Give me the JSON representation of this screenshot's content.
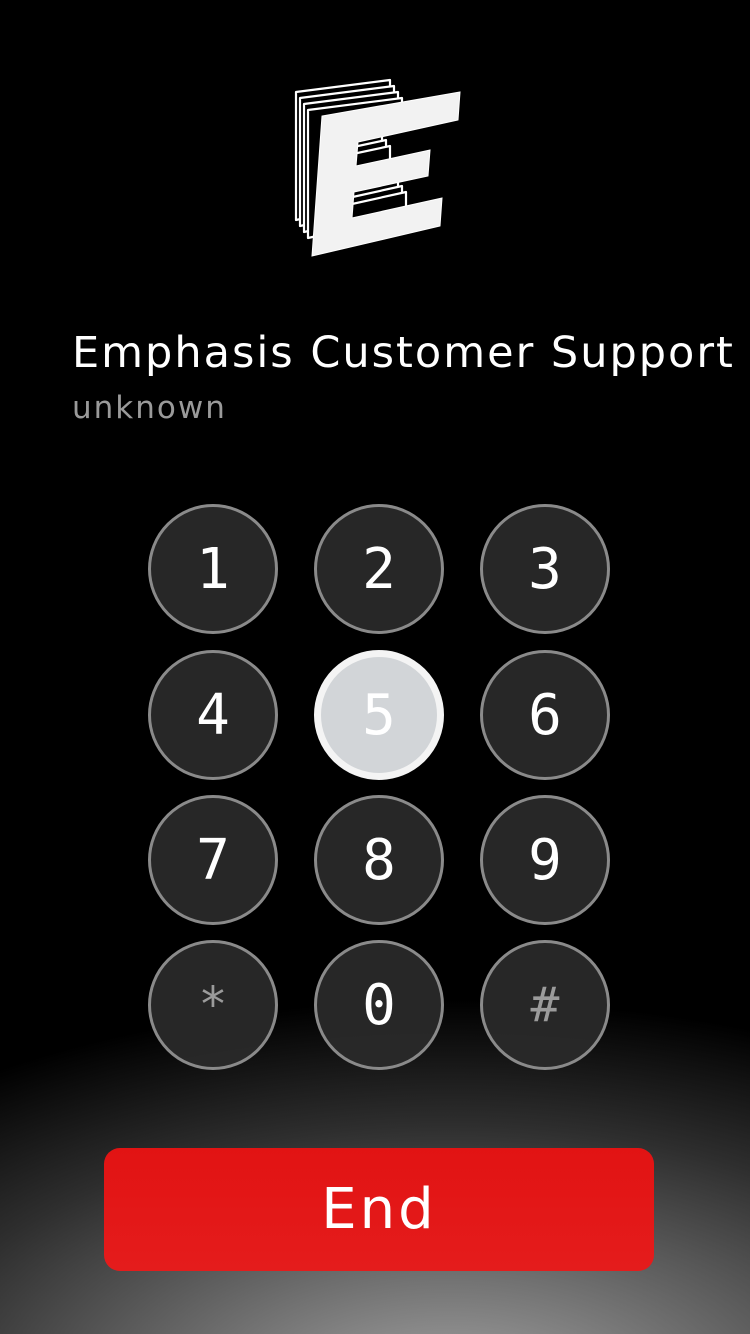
{
  "logo": {
    "icon": "emphasis-e-logo-icon"
  },
  "caller": {
    "name": "Emphasis Customer Support",
    "status": "unknown"
  },
  "keypad": {
    "keys": [
      "1",
      "2",
      "3",
      "4",
      "5",
      "6",
      "7",
      "8",
      "9",
      "*",
      "0",
      "#"
    ],
    "pressed_key": "5"
  },
  "end_button": {
    "label": "End"
  },
  "colors": {
    "end_button": "#e31818",
    "key_fill": "#2a2a2a",
    "key_border": "#8a8a8a",
    "key_pressed_fill": "#d2d5d8",
    "status_text": "#9a9a9a"
  }
}
